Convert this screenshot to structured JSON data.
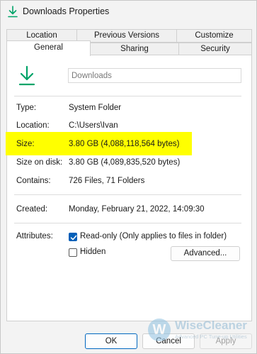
{
  "window": {
    "title": "Downloads Properties",
    "icon": "download-arrow-icon",
    "accent_color": "#00a368"
  },
  "tabs": {
    "row_top": [
      "Location",
      "Previous Versions",
      "Customize"
    ],
    "row_bottom": [
      "General",
      "Sharing",
      "Security"
    ],
    "active": "General"
  },
  "general": {
    "folder_icon": "download-arrow-icon",
    "name_value": "Downloads",
    "fields": {
      "type": {
        "label": "Type:",
        "value": "System Folder"
      },
      "location": {
        "label": "Location:",
        "value": "C:\\Users\\Ivan"
      },
      "size": {
        "label": "Size:",
        "value": "3.80 GB (4,088,118,564 bytes)"
      },
      "size_on_disk": {
        "label": "Size on disk:",
        "value": "3.80 GB (4,089,835,520 bytes)"
      },
      "contains": {
        "label": "Contains:",
        "value": "726 Files, 71 Folders"
      },
      "created": {
        "label": "Created:",
        "value": "Monday, February 21, 2022, 14:09:30"
      }
    },
    "highlight_color": "#ffff00",
    "attributes": {
      "label": "Attributes:",
      "readonly_label": "Read-only (Only applies to files in folder)",
      "readonly_checked": true,
      "hidden_label": "Hidden",
      "hidden_checked": false,
      "advanced_button": "Advanced..."
    }
  },
  "footer": {
    "ok": "OK",
    "cancel": "Cancel",
    "apply": "Apply"
  },
  "watermark": {
    "logo_letter": "W",
    "name": "WiseCleaner",
    "tagline": "Advanced PC Tune-up Utilities"
  }
}
